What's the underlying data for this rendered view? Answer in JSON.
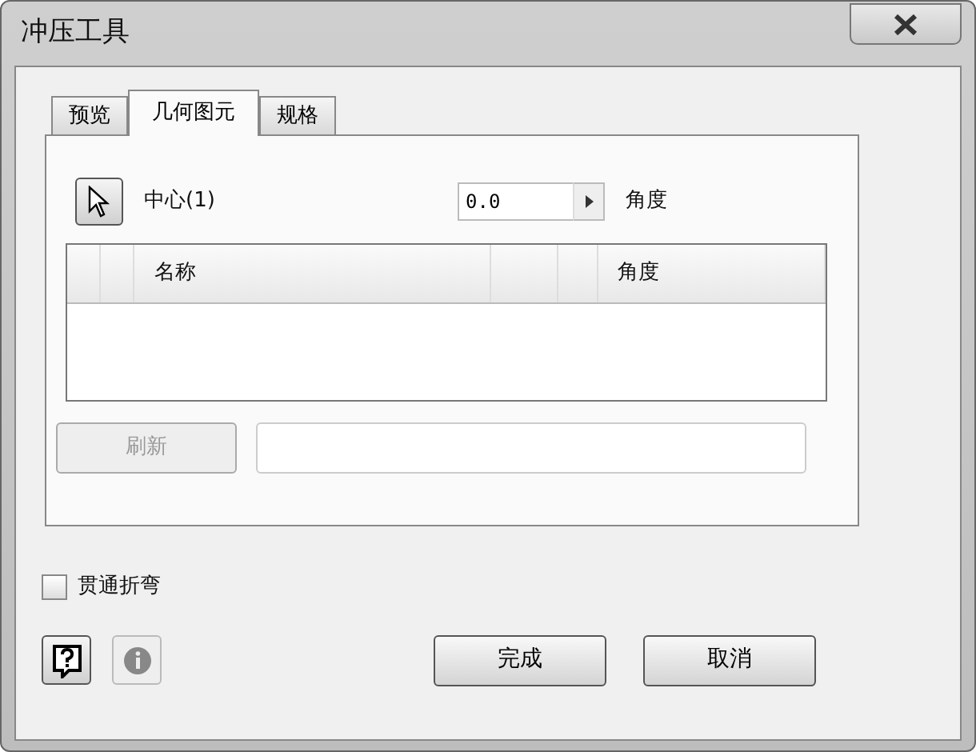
{
  "window": {
    "title": "冲压工具"
  },
  "tabs": [
    {
      "label": "预览",
      "selected": false
    },
    {
      "label": "几何图元",
      "selected": true
    },
    {
      "label": "规格",
      "selected": false
    }
  ],
  "center_picker": {
    "label": "中心(1)",
    "selected": false
  },
  "angle_field": {
    "value": "0.0",
    "label": "角度"
  },
  "table": {
    "columns": [
      {
        "label": "名称"
      },
      {
        "label": "角度"
      }
    ]
  },
  "refresh_button": {
    "label": "刷新",
    "disabled": true
  },
  "through_bend": {
    "label": "贯通折弯",
    "checked": false
  },
  "help_button": {
    "disabled": false
  },
  "info_button": {
    "disabled": true
  },
  "buttons": [
    {
      "label": "完成"
    },
    {
      "label": "取消"
    }
  ]
}
